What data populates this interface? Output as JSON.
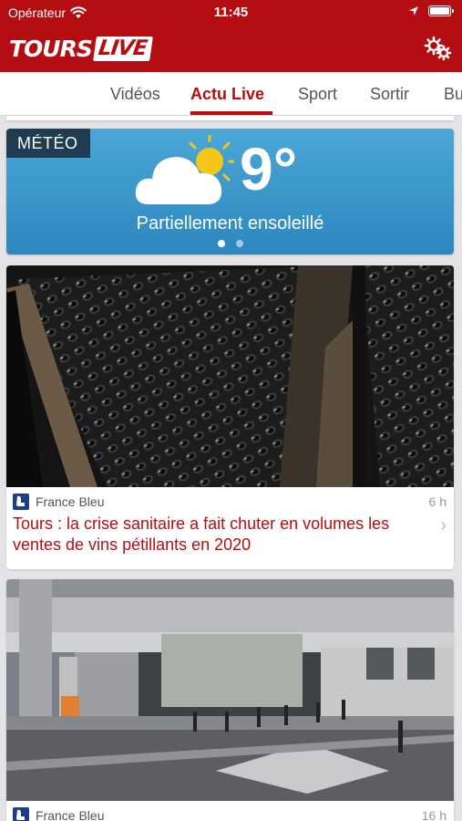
{
  "status_bar": {
    "carrier": "Opérateur",
    "time": "11:45",
    "battery_level": 1.0
  },
  "app": {
    "logo_left": "TOURS",
    "logo_right": "LIVE"
  },
  "tabs": [
    {
      "label": "Vidéos",
      "active": false
    },
    {
      "label": "Actu Live",
      "active": true
    },
    {
      "label": "Sport",
      "active": false
    },
    {
      "label": "Sortir",
      "active": false
    },
    {
      "label": "Bu",
      "active": false
    }
  ],
  "weather": {
    "tag": "MÉTÉO",
    "temperature": "9°",
    "description": "Partiellement ensoleillé",
    "icon": "partly-sunny-icon",
    "carousel_count": 2,
    "carousel_active_index": 0
  },
  "news": [
    {
      "source": "France Bleu",
      "age": "6 h",
      "title": "Tours : la crise sanitaire a fait chuter en volumes les ventes de vins pétillants en 2020"
    },
    {
      "source": "France Bleu",
      "age": "16 h"
    }
  ],
  "colors": {
    "brand_red": "#b50e12",
    "weather_tag_bg": "#1f3c52",
    "weather_sky": "#3b97cc",
    "source_icon_bg": "#1e3c8c"
  }
}
